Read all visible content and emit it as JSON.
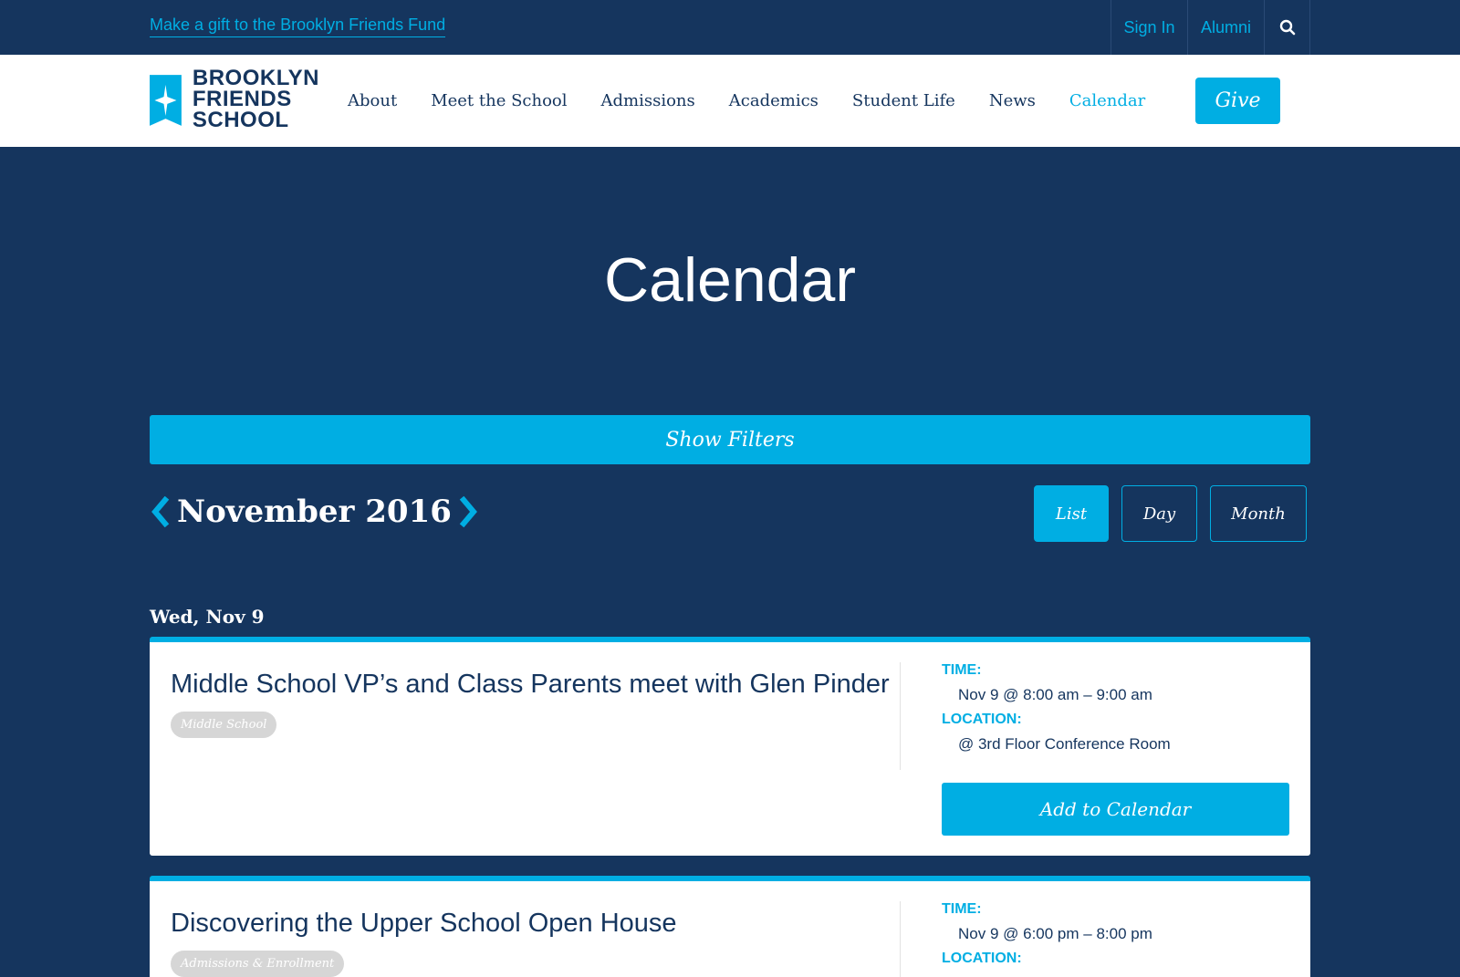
{
  "utility": {
    "gift_link": "Make a gift to the Brooklyn Friends Fund",
    "sign_in": "Sign In",
    "alumni": "Alumni",
    "search_icon": "search-icon"
  },
  "logo": {
    "line1": "BROOKLYN",
    "line2": "FRIENDS",
    "line3": "SCHOOL"
  },
  "nav": {
    "items": [
      "About",
      "Meet the School",
      "Admissions",
      "Academics",
      "Student Life",
      "News",
      "Calendar"
    ],
    "active": "Calendar",
    "give": "Give"
  },
  "page": {
    "title": "Calendar",
    "filters_label": "Show Filters",
    "month": "November 2016",
    "views": [
      "List",
      "Day",
      "Month"
    ],
    "active_view": "List",
    "day_heading": "Wed, Nov 9"
  },
  "events": [
    {
      "title": "Middle School VP’s and Class Parents meet with Glen Pinder",
      "tag": "Middle School",
      "time_label": "Time:",
      "time": "Nov 9 @ 8:00 am – 9:00 am",
      "location_label": "Location:",
      "location": "@ 3rd Floor Conference Room",
      "add_label": "Add to Calendar"
    },
    {
      "title": "Discovering the Upper School Open House",
      "tag": "Admissions & Enrollment",
      "time_label": "Time:",
      "time": "Nov 9 @ 6:00 pm – 8:00 pm",
      "location_label": "Location:"
    }
  ],
  "colors": {
    "navy": "#15355e",
    "accent": "#00aee3",
    "tag_gray": "#d6d6d6"
  }
}
